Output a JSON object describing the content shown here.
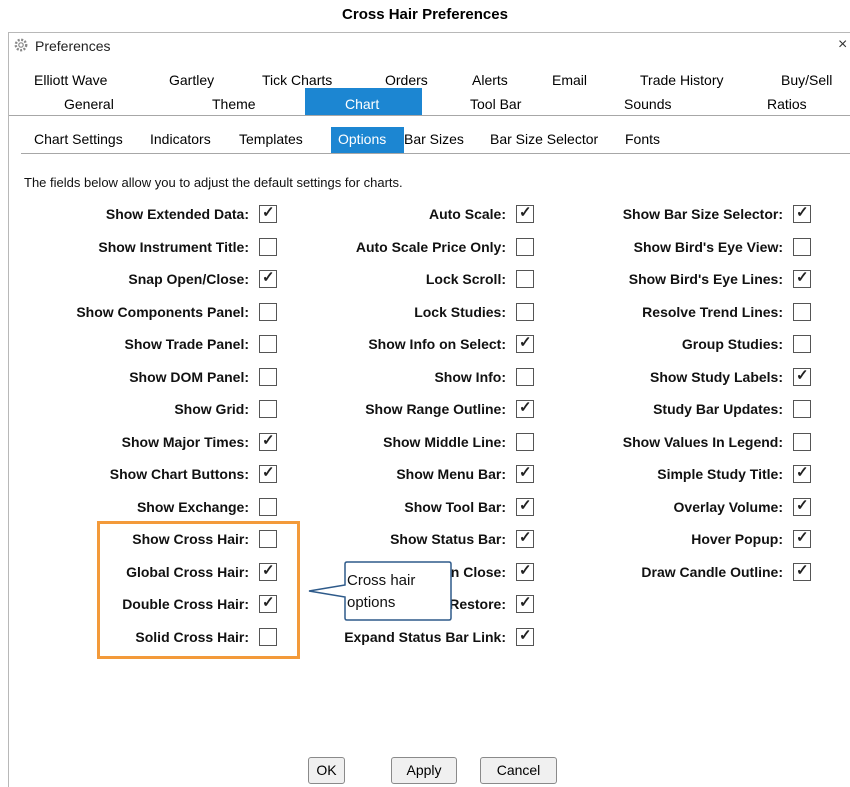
{
  "doc_title": "Cross Hair Preferences",
  "window": {
    "title": "Preferences",
    "close_glyph": "×",
    "icon": "gear-icon"
  },
  "tabs_row1": [
    "Elliott Wave",
    "Gartley",
    "Tick Charts",
    "Orders",
    "Alerts",
    "Email",
    "Trade History",
    "Buy/Sell"
  ],
  "tabs_row2": [
    "General",
    "Theme",
    "Chart",
    "Tool Bar",
    "Sounds",
    "Ratios"
  ],
  "active_tab": "Chart",
  "subtabs": [
    "Chart Settings",
    "Indicators",
    "Templates",
    "Options",
    "Bar Sizes",
    "Bar Size Selector",
    "Fonts"
  ],
  "active_subtab": "Options",
  "description": "The fields below allow you to adjust the default settings for charts.",
  "columns": [
    [
      {
        "label": "Show Extended Data:",
        "checked": true
      },
      {
        "label": "Show Instrument Title:",
        "checked": false
      },
      {
        "label": "Snap Open/Close:",
        "checked": true
      },
      {
        "label": "Show Components Panel:",
        "checked": false
      },
      {
        "label": "Show Trade Panel:",
        "checked": false
      },
      {
        "label": "Show DOM Panel:",
        "checked": false
      },
      {
        "label": "Show Grid:",
        "checked": false
      },
      {
        "label": "Show Major Times:",
        "checked": true
      },
      {
        "label": "Show Chart Buttons:",
        "checked": true
      },
      {
        "label": "Show Exchange:",
        "checked": false
      },
      {
        "label": "Show Cross Hair:",
        "checked": false
      },
      {
        "label": "Global Cross Hair:",
        "checked": true
      },
      {
        "label": "Double Cross Hair:",
        "checked": true
      },
      {
        "label": "Solid Cross Hair:",
        "checked": false
      }
    ],
    [
      {
        "label": "Auto Scale:",
        "checked": true
      },
      {
        "label": "Auto Scale Price Only:",
        "checked": false
      },
      {
        "label": "Lock Scroll:",
        "checked": false
      },
      {
        "label": "Lock Studies:",
        "checked": false
      },
      {
        "label": "Show Info on Select:",
        "checked": true
      },
      {
        "label": "Show Info:",
        "checked": false
      },
      {
        "label": "Show Range Outline:",
        "checked": true
      },
      {
        "label": "Show Middle Line:",
        "checked": false
      },
      {
        "label": "Show Menu Bar:",
        "checked": true
      },
      {
        "label": "Show Tool Bar:",
        "checked": true
      },
      {
        "label": "Show Status Bar:",
        "checked": true
      },
      {
        "label": "on Close:",
        "checked": true
      },
      {
        "label": "e/Restore:",
        "checked": true
      },
      {
        "label": "Expand Status Bar Link:",
        "checked": true
      }
    ],
    [
      {
        "label": "Show Bar Size Selector:",
        "checked": true
      },
      {
        "label": "Show Bird's Eye View:",
        "checked": false
      },
      {
        "label": "Show Bird's Eye Lines:",
        "checked": true
      },
      {
        "label": "Resolve Trend Lines:",
        "checked": false
      },
      {
        "label": "Group Studies:",
        "checked": false
      },
      {
        "label": "Show Study Labels:",
        "checked": true
      },
      {
        "label": "Study Bar Updates:",
        "checked": false
      },
      {
        "label": "Show Values In Legend:",
        "checked": false
      },
      {
        "label": "Simple Study Title:",
        "checked": true
      },
      {
        "label": "Overlay Volume:",
        "checked": true
      },
      {
        "label": "Hover Popup:",
        "checked": true
      },
      {
        "label": "Draw Candle Outline:",
        "checked": true
      }
    ]
  ],
  "check_glyph": "✓",
  "callout": {
    "text": "Cross hair options"
  },
  "buttons": {
    "ok": "OK",
    "apply": "Apply",
    "cancel": "Cancel"
  },
  "colors": {
    "accent": "#1c86d2",
    "highlight": "#f39a3a",
    "callout_border": "#2e5a8a"
  }
}
